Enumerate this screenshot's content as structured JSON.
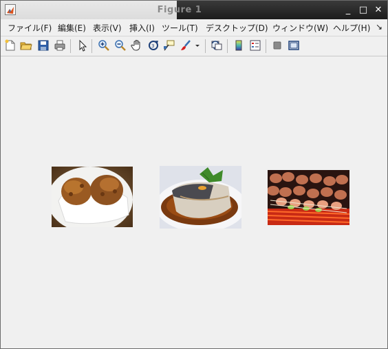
{
  "window": {
    "title": "Figure 1",
    "buttons": {
      "minimize": "_",
      "maximize": "□",
      "close": "✕"
    }
  },
  "menubar": {
    "items": [
      "ファイル(F)",
      "編集(E)",
      "表示(V)",
      "挿入(I)",
      "ツール(T)",
      "デスクトップ(D)",
      "ウィンドウ(W)",
      "ヘルプ(H)"
    ],
    "overflow": "↘"
  },
  "toolbar": {
    "buttons": [
      "new-figure-icon",
      "open-file-icon",
      "save-icon",
      "print-icon",
      "select-arrow-icon",
      "zoom-in-icon",
      "zoom-out-icon",
      "pan-hand-icon",
      "rotate-3d-icon",
      "data-cursor-icon",
      "brush-icon",
      "brush-dropdown-icon",
      "link-plot-icon",
      "colorbar-icon",
      "legend-icon",
      "hide-plot-tools-icon",
      "show-plot-tools-icon"
    ]
  },
  "figure": {
    "images": [
      {
        "name": "fried-chicken-image",
        "subject": "karaage on plate"
      },
      {
        "name": "simmered-fish-image",
        "subject": "simmered fish fillet"
      },
      {
        "name": "yakitori-image",
        "subject": "grilled skewers"
      }
    ]
  }
}
